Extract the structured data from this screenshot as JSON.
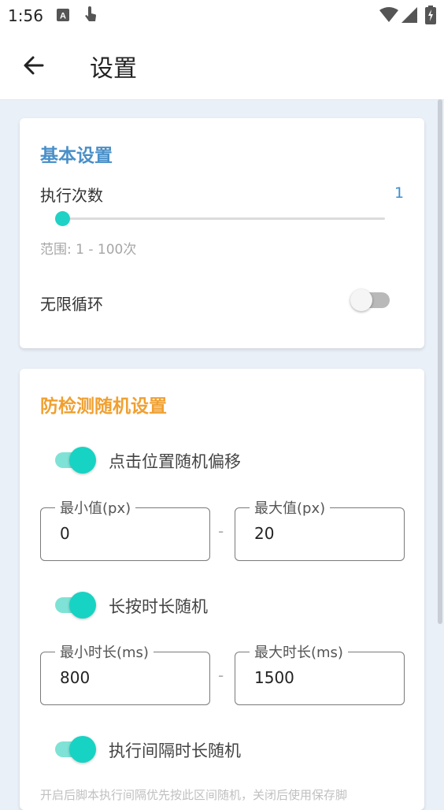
{
  "status": {
    "time": "1:56"
  },
  "appbar": {
    "title": "设置"
  },
  "basic": {
    "title": "基本设置",
    "exec_count_label": "执行次数",
    "exec_count_value": "1",
    "exec_count_fraction": 0.0,
    "range_hint": "范围: 1 - 100次",
    "infinite_loop_label": "无限循环",
    "infinite_loop_on": false
  },
  "anti": {
    "title": "防检测随机设置",
    "click_offset": {
      "label": "点击位置随机偏移",
      "on": true,
      "min_label": "最小值(px)",
      "min_value": "0",
      "max_label": "最大值(px)",
      "max_value": "20"
    },
    "long_press": {
      "label": "长按时长随机",
      "on": true,
      "min_label": "最小时长(ms)",
      "min_value": "800",
      "max_label": "最大时长(ms)",
      "max_value": "1500"
    },
    "interval": {
      "label": "执行间隔时长随机",
      "on": true
    },
    "dash": "-",
    "footnote": "开启后脚本执行间隔优先按此区间随机，关闭后使用保存脚"
  },
  "colors": {
    "accent_teal": "#17d3c3",
    "basic_title": "#4a90c8",
    "anti_title": "#f0a030",
    "value_blue": "#3a8ed0"
  },
  "icons": [
    "a-box-icon",
    "touch-icon",
    "wifi-icon",
    "signal-icon",
    "battery-icon",
    "back-arrow-icon"
  ]
}
